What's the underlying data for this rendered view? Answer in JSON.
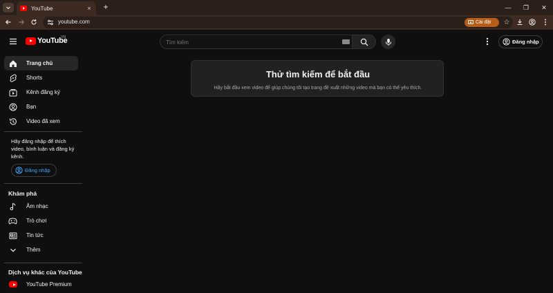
{
  "browser": {
    "tab_title": "YouTube",
    "url": "youtube.com",
    "install_label": "Cài đặt",
    "close_glyph": "×",
    "new_tab_glyph": "+",
    "star_glyph": "☆",
    "win_minimize": "—",
    "win_restore": "❐",
    "win_close": "✕"
  },
  "masthead": {
    "logo_text": "YouTube",
    "country_code": "VN",
    "search_placeholder": "Tìm kiếm",
    "signin_label": "Đăng nhập"
  },
  "sidebar": {
    "items": [
      {
        "label": "Trang chủ",
        "icon": "home-icon"
      },
      {
        "label": "Shorts",
        "icon": "shorts-icon"
      },
      {
        "label": "Kênh đăng ký",
        "icon": "subscriptions-icon"
      },
      {
        "label": "Bạn",
        "icon": "you-icon"
      },
      {
        "label": "Video đã xem",
        "icon": "history-icon"
      }
    ],
    "signin_prompt": "Hãy đăng nhập để thích video, bình luận và đăng ký kênh.",
    "signin_label": "Đăng nhập",
    "explore_heading": "Khám phá",
    "explore_items": [
      {
        "label": "Âm nhạc",
        "icon": "music-icon"
      },
      {
        "label": "Trò chơi",
        "icon": "gaming-icon"
      },
      {
        "label": "Tin tức",
        "icon": "news-icon"
      },
      {
        "label": "Thêm",
        "icon": "chevron-down-icon"
      }
    ],
    "more_heading": "Dịch vụ khác của YouTube",
    "more_items": [
      {
        "label": "YouTube Premium",
        "icon": "youtube-premium-icon"
      }
    ]
  },
  "main": {
    "prompt_title": "Thử tìm kiếm để bắt đầu",
    "prompt_subtitle": "Hãy bắt đầu xem video để giúp chúng tôi tạo trang đề xuất những video mà bạn có thể yêu thích."
  },
  "colors": {
    "background": "#0f0f0f",
    "browser_chrome": "#3d2a20",
    "accent_red": "#ff0000",
    "link_blue": "#3ea6ff",
    "install_orange": "#b85c1a"
  }
}
